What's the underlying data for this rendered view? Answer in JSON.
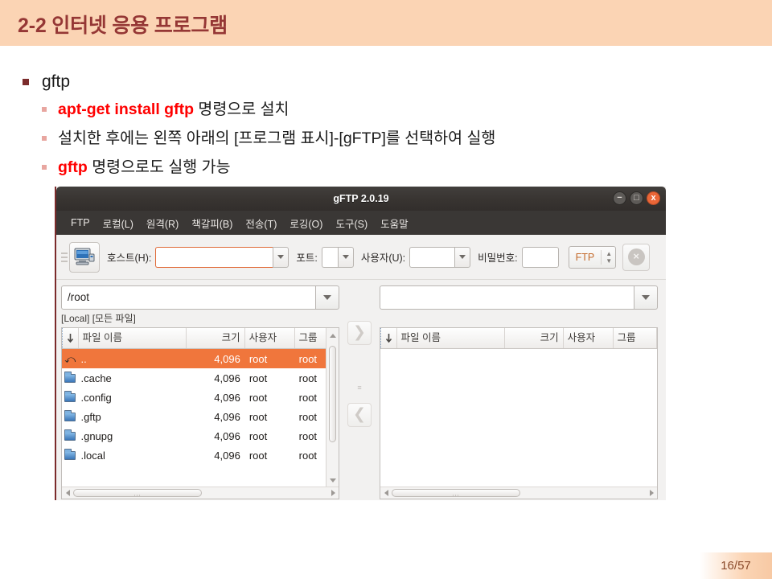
{
  "header": {
    "title": "2-2 인터넷 응용 프로그램"
  },
  "bullets": {
    "level1": "gftp",
    "items": [
      {
        "red": "apt-get install gftp",
        "rest": " 명령으로 설치"
      },
      {
        "red": "",
        "rest": "설치한 후에는 왼쪽 아래의 [프로그램 표시]-[gFTP]를 선택하여 실행"
      },
      {
        "red": "gftp",
        "rest": " 명령으로도 실행 가능"
      }
    ]
  },
  "gftp": {
    "titlebar": {
      "title": "gFTP 2.0.19",
      "minimize": "−",
      "maximize": "□",
      "close": "x"
    },
    "menu": [
      "FTP",
      "로컬(L)",
      "원격(R)",
      "책갈피(B)",
      "전송(T)",
      "로깅(O)",
      "도구(S)",
      "도움말"
    ],
    "toolbar": {
      "host_label": "호스트(H):",
      "host_value": "",
      "port_label": "포트:",
      "port_value": "",
      "user_label": "사용자(U):",
      "user_value": "",
      "pass_label": "비밀번호:",
      "pass_value": "",
      "protocol": "FTP",
      "stop_icon": "×"
    },
    "local_pane": {
      "path": "/root",
      "status": "[Local] [모든 파일]",
      "columns": [
        "파일 이름",
        "크기",
        "사용자",
        "그룹"
      ],
      "rows": [
        {
          "icon": "up-dir-icon",
          "name": "..",
          "size": "4,096",
          "user": "root",
          "group": "root",
          "selected": true
        },
        {
          "icon": "folder-icon",
          "name": ".cache",
          "size": "4,096",
          "user": "root",
          "group": "root",
          "selected": false
        },
        {
          "icon": "folder-icon",
          "name": ".config",
          "size": "4,096",
          "user": "root",
          "group": "root",
          "selected": false
        },
        {
          "icon": "folder-icon",
          "name": ".gftp",
          "size": "4,096",
          "user": "root",
          "group": "root",
          "selected": false
        },
        {
          "icon": "folder-icon",
          "name": ".gnupg",
          "size": "4,096",
          "user": "root",
          "group": "root",
          "selected": false
        },
        {
          "icon": "folder-icon",
          "name": ".local",
          "size": "4,096",
          "user": "root",
          "group": "root",
          "selected": false
        }
      ]
    },
    "remote_pane": {
      "path": "",
      "status": "",
      "columns": [
        "파일 이름",
        "크기",
        "사용자",
        "그룹"
      ],
      "rows": []
    },
    "transfer": {
      "to_remote": "❯",
      "to_local": "❮"
    }
  },
  "footer": {
    "page": "16/57"
  },
  "colors": {
    "header_bg": "#fbd4b4",
    "header_text": "#953735",
    "accent_red": "#ff0000",
    "selection": "#f0763c",
    "titlebar": "#383431"
  }
}
